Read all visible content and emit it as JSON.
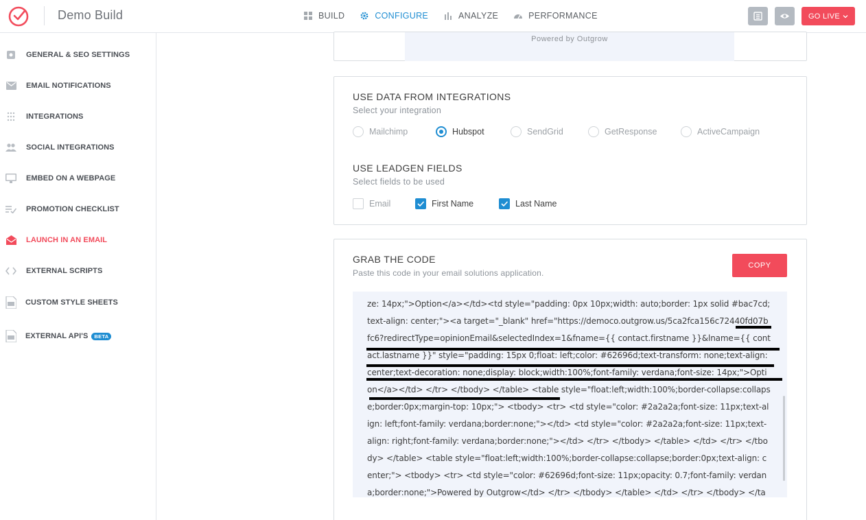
{
  "app": {
    "title": "Demo Build"
  },
  "nav": [
    {
      "label": "BUILD",
      "icon": "build-icon"
    },
    {
      "label": "CONFIGURE",
      "icon": "gear-icon",
      "active": true
    },
    {
      "label": "ANALYZE",
      "icon": "bar-chart-icon"
    },
    {
      "label": "PERFORMANCE",
      "icon": "gauge-icon"
    }
  ],
  "toolbar": {
    "go_live": "GO LIVE"
  },
  "sidebar": {
    "items": [
      {
        "label": "GENERAL & SEO SETTINGS",
        "icon": "settings-icon"
      },
      {
        "label": "EMAIL NOTIFICATIONS",
        "icon": "mail-icon"
      },
      {
        "label": "INTEGRATIONS",
        "icon": "grid-icon"
      },
      {
        "label": "SOCIAL INTEGRATIONS",
        "icon": "people-icon"
      },
      {
        "label": "EMBED ON A WEBPAGE",
        "icon": "monitor-icon"
      },
      {
        "label": "PROMOTION CHECKLIST",
        "icon": "checklist-icon"
      },
      {
        "label": "LAUNCH IN AN EMAIL",
        "icon": "open-mail-icon",
        "active": true
      },
      {
        "label": "EXTERNAL SCRIPTS",
        "icon": "code-icon"
      },
      {
        "label": "CUSTOM STYLE SHEETS",
        "icon": "css-file-icon"
      },
      {
        "label": "EXTERNAL API'S",
        "icon": "api-file-icon",
        "badge": "BETA"
      }
    ]
  },
  "preview": {
    "powered_by": "Powered by Outgrow"
  },
  "integrations": {
    "title": "USE DATA FROM INTEGRATIONS",
    "subtitle": "Select your integration",
    "options": [
      "Mailchimp",
      "Hubspot",
      "SendGrid",
      "GetResponse",
      "ActiveCampaign"
    ],
    "selected": "Hubspot"
  },
  "leadgen": {
    "title": "USE LEADGEN FIELDS",
    "subtitle": "Select fields to be used",
    "fields": [
      {
        "label": "Email",
        "checked": false
      },
      {
        "label": "First Name",
        "checked": true
      },
      {
        "label": "Last Name",
        "checked": true
      }
    ]
  },
  "grab_code": {
    "title": "GRAB THE CODE",
    "subtitle": "Paste this code in your email solutions application.",
    "copy_label": "COPY",
    "code": "none;text-align: center;text-decoration: none;display: block;width:100%;font-family: verdana;font-size: 14px;\">Option</a></td><td style=\"padding: 0px 10px;width: auto;border: 1px solid #bac7cd;text-align: center;\"><a target=\"_blank\" href=\"https://democo.outgrow.us/5ca2fca156c72440fd07bfc6?redirectType=opinionEmail&selectedIndex=1&fname={{ contact.firstname }}&lname={{ contact.lastname }}\" style=\"padding: 15px 0;float: left;color: #62696d;text-transform: none;text-align: center;text-decoration: none;display: block;width:100%;font-family: verdana;font-size: 14px;\">Option</a></td> </tr> </tbody> </table> <table style=\"float:left;width:100%;border-collapse:collapse;border:0px;margin-top: 10px;\"> <tbody> <tr> <td style=\"color: #2a2a2a;font-size: 11px;text-align: left;font-family: verdana;border:none;\"></td> <td style=\"color: #2a2a2a;font-size: 11px;text-align: right;font-family: verdana;border:none;\"></td> </tr> </tbody> </table> </td> </tr> </tbody> </table> <table style=\"float:left;width:100%;border-collapse:collapse;border:0px;text-align: center;\"> <tbody> <tr> <td style=\"color: #62696d;font-size: 11px;opacity: 0.7;font-family: verdana;border:none;\">Powered by Outgrow</td> </tr> </tbody> </table> </td> </tr> </tbody> </table> </td> </tr> </tbody> </table>"
  },
  "colors": {
    "accent": "#1e8dd2",
    "brand": "#f24b5b",
    "code_bg": "#f1f4fb"
  }
}
